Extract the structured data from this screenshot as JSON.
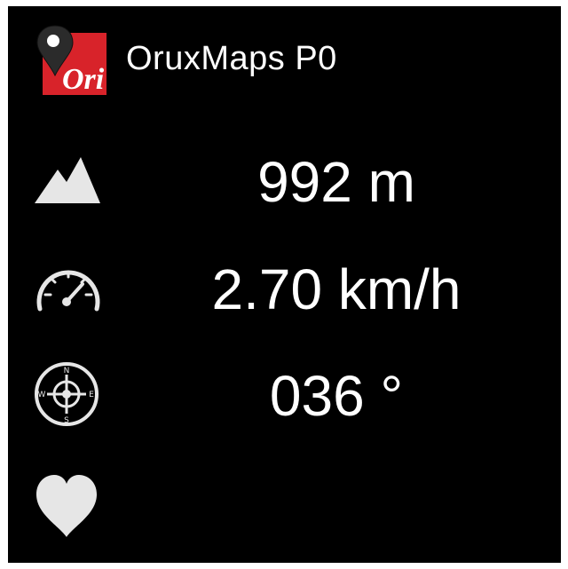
{
  "app": {
    "title": "OruxMaps P0",
    "logo_text": "Ori",
    "logo_color": "#d8232a"
  },
  "metrics": {
    "altitude": {
      "icon": "mountain-icon",
      "value": "992 m"
    },
    "speed": {
      "icon": "speedometer-icon",
      "value": "2.70 km/h"
    },
    "heading": {
      "icon": "compass-icon",
      "value": "036 °"
    },
    "heart_rate": {
      "icon": "heart-icon",
      "value": ""
    }
  },
  "compass_letters": {
    "n": "N",
    "s": "S",
    "e": "E",
    "w": "W"
  },
  "colors": {
    "background": "#000000",
    "text": "#ffffff",
    "icon": "#e6e6e6"
  }
}
